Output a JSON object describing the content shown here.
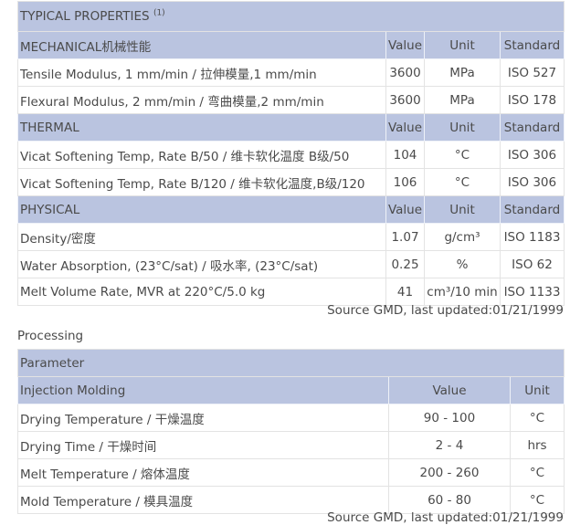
{
  "properties": {
    "title": "TYPICAL PROPERTIES",
    "title_note": "(1)",
    "sections": [
      {
        "name": "MECHANICAL机械性能",
        "headers": {
          "value": "Value",
          "unit": "Unit",
          "standard": "Standard"
        },
        "rows": [
          {
            "property": "Tensile Modulus, 1 mm/min / 拉伸模量,1 mm/min",
            "value": "3600",
            "unit": "MPa",
            "standard": "ISO 527"
          },
          {
            "property": "Flexural Modulus, 2 mm/min / 弯曲模量,2 mm/min",
            "value": "3600",
            "unit": "MPa",
            "standard": "ISO 178"
          }
        ]
      },
      {
        "name": "THERMAL",
        "headers": {
          "value": "Value",
          "unit": "Unit",
          "standard": "Standard"
        },
        "rows": [
          {
            "property": "Vicat Softening Temp, Rate B/50 / 维卡软化温度 B级/50",
            "value": "104",
            "unit": "°C",
            "standard": "ISO 306"
          },
          {
            "property": "Vicat Softening Temp, Rate B/120 / 维卡软化温度,B级/120",
            "value": "106",
            "unit": "°C",
            "standard": "ISO 306"
          }
        ]
      },
      {
        "name": "PHYSICAL",
        "headers": {
          "value": "Value",
          "unit": "Unit",
          "standard": "Standard"
        },
        "rows": [
          {
            "property": "Density/密度",
            "value": "1.07",
            "unit": "g/cm³",
            "standard": "ISO 1183"
          },
          {
            "property": "Water Absorption, (23°C/sat) / 吸水率, (23°C/sat)",
            "value": "0.25",
            "unit": "%",
            "standard": "ISO 62"
          },
          {
            "property": "Melt Volume Rate, MVR at 220°C/5.0 kg",
            "value": "41",
            "unit": "cm³/10 min",
            "standard": "ISO 1133"
          }
        ]
      }
    ],
    "source": "Source GMD, last updated:01/21/1999"
  },
  "processing": {
    "label": "Processing",
    "title": "Parameter",
    "section": {
      "name": "Injection Molding",
      "headers": {
        "value": "Value",
        "unit": "Unit"
      },
      "rows": [
        {
          "parameter": "Drying Temperature / 干燥温度",
          "value": "90 - 100",
          "unit": "°C"
        },
        {
          "parameter": "Drying Time / 干燥时间",
          "value": "2 - 4",
          "unit": "hrs"
        },
        {
          "parameter": "Melt Temperature / 熔体温度",
          "value": "200 - 260",
          "unit": "°C"
        },
        {
          "parameter": "Mold Temperature / 模具温度",
          "value": "60 - 80",
          "unit": "°C"
        }
      ]
    },
    "source": "Source GMD, last updated:01/21/1999"
  }
}
